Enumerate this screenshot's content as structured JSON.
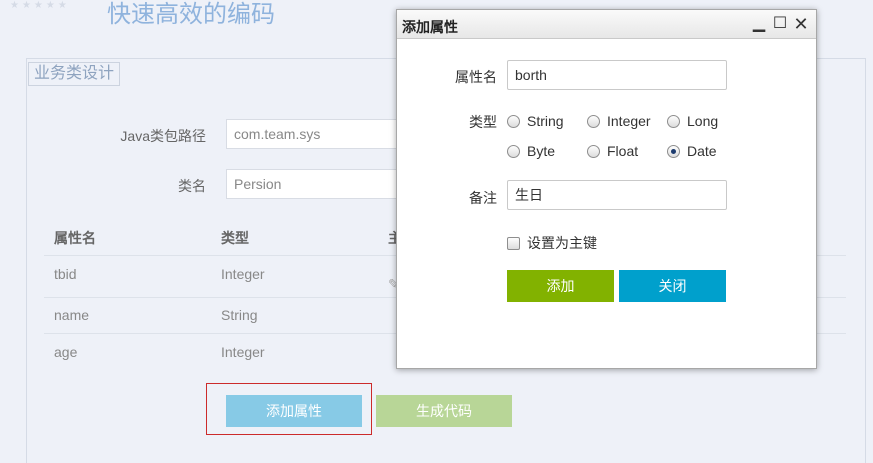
{
  "page": {
    "title": "快速高效的编码",
    "section_legend": "业务类设计"
  },
  "form": {
    "package_label": "Java类包路径",
    "package_value": "com.team.sys",
    "class_label": "类名",
    "class_value": "Persion"
  },
  "table": {
    "columns": [
      "属性名",
      "类型",
      "主"
    ],
    "rows": [
      {
        "name": "tbid",
        "type": "Integer"
      },
      {
        "name": "name",
        "type": "String"
      },
      {
        "name": "age",
        "type": "Integer"
      }
    ]
  },
  "buttons": {
    "add_attr": "添加属性",
    "generate": "生成代码"
  },
  "dialog": {
    "title": "添加属性",
    "name_label": "属性名",
    "name_value": "borth",
    "type_label": "类型",
    "type_options": [
      "String",
      "Integer",
      "Long",
      "Byte",
      "Float",
      "Date"
    ],
    "selected_type": "Date",
    "remark_label": "备注",
    "remark_value": "生日",
    "primary_key_label": "设置为主键",
    "primary_key_checked": false,
    "add_button": "添加",
    "close_button": "关闭"
  },
  "colors": {
    "add_button": "#82b200",
    "close_button": "#00a0cc",
    "add_attr_button": "#87cae6",
    "generate_button": "#b8d697",
    "highlight_border": "#cc2b2b"
  }
}
